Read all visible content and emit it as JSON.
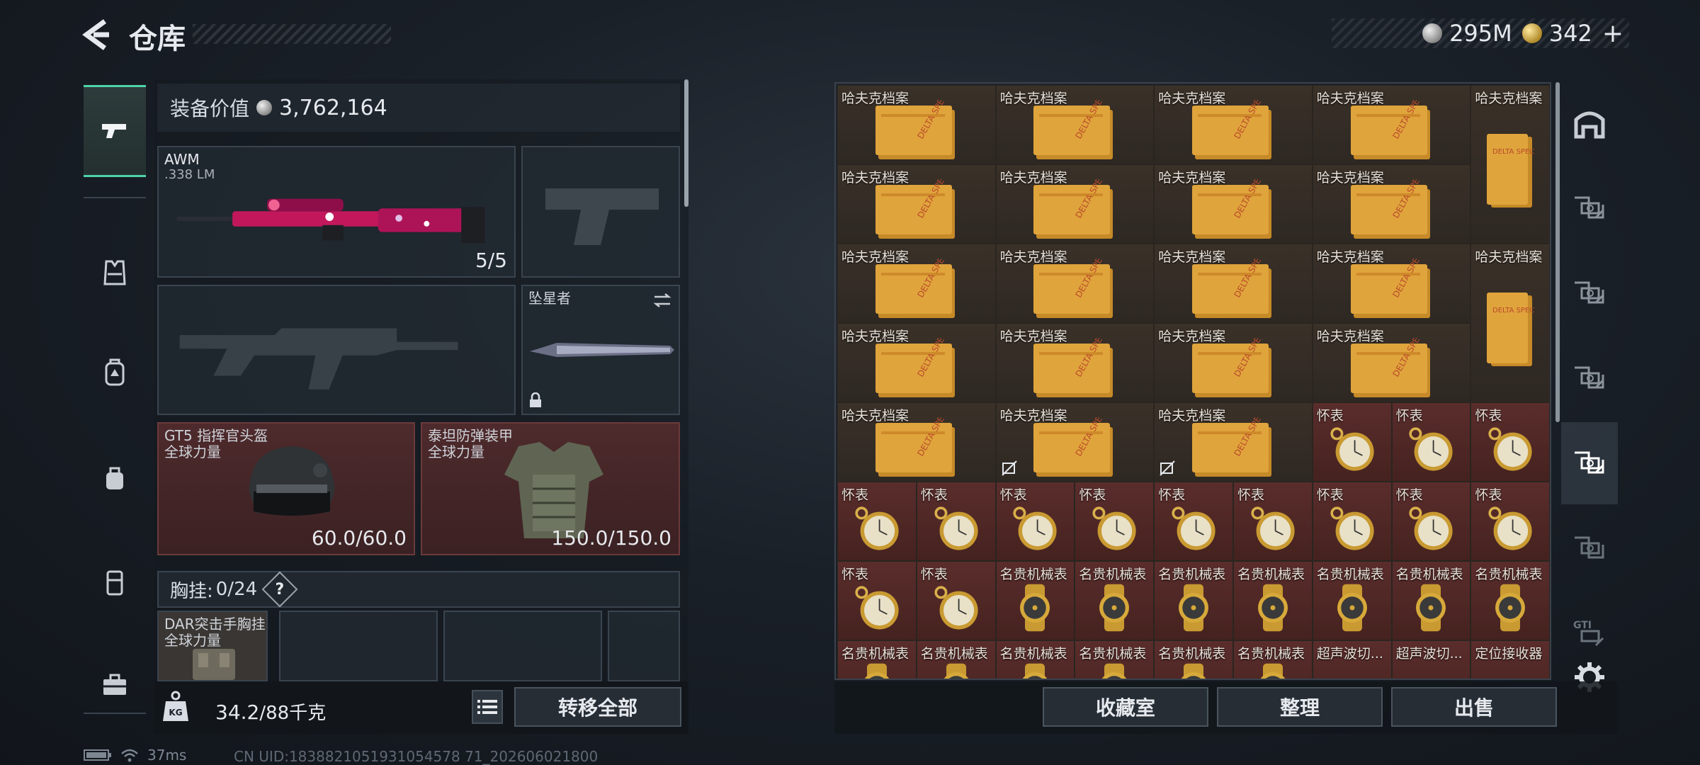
{
  "header": {
    "title": "仓库",
    "currency_silver": "295M",
    "currency_gold": "342",
    "plus": "+"
  },
  "left_rail": {
    "items": [
      "pistol-icon",
      "vest-icon",
      "backpack-icon",
      "bag-icon",
      "case-icon",
      "toolbox-icon"
    ]
  },
  "equipment": {
    "value_label": "装备价值",
    "value": "3,762,164",
    "primary_weapon": {
      "name": "AWM",
      "ammo": ".338 LM",
      "count": "5/5"
    },
    "melee": {
      "name": "坠星者"
    },
    "helmet": {
      "name": "GT5 指挥官头盔",
      "sub": "全球力量",
      "durability": "60.0/60.0"
    },
    "armor": {
      "name": "泰坦防弹装甲",
      "sub": "全球力量",
      "durability": "150.0/150.0"
    },
    "chest_rig": {
      "label": "胸挂:",
      "capacity": "0/24",
      "help": "?"
    },
    "rig_item": {
      "name": "DAR突击手胸挂",
      "sub": "全球力量"
    },
    "weight": "34.2",
    "weight_max": "/88千克",
    "transfer_all": "转移全部"
  },
  "status": {
    "ping": "37ms",
    "uid": "CN UID:1838821051931054578 71_202606021800"
  },
  "storage": {
    "archive_label": "哈夫克档案",
    "watch_label": "怀表",
    "luxury_label": "名贵机械表",
    "ultrasonic_label": "超声波切...",
    "locator_label": "定位接收器",
    "buttons": {
      "collection": "收藏室",
      "sort": "整理",
      "sell": "出售"
    }
  },
  "colors": {
    "accent": "#4fd3a8",
    "red_slot": "#4e2a2c",
    "brown_cell": "#3a3128"
  }
}
